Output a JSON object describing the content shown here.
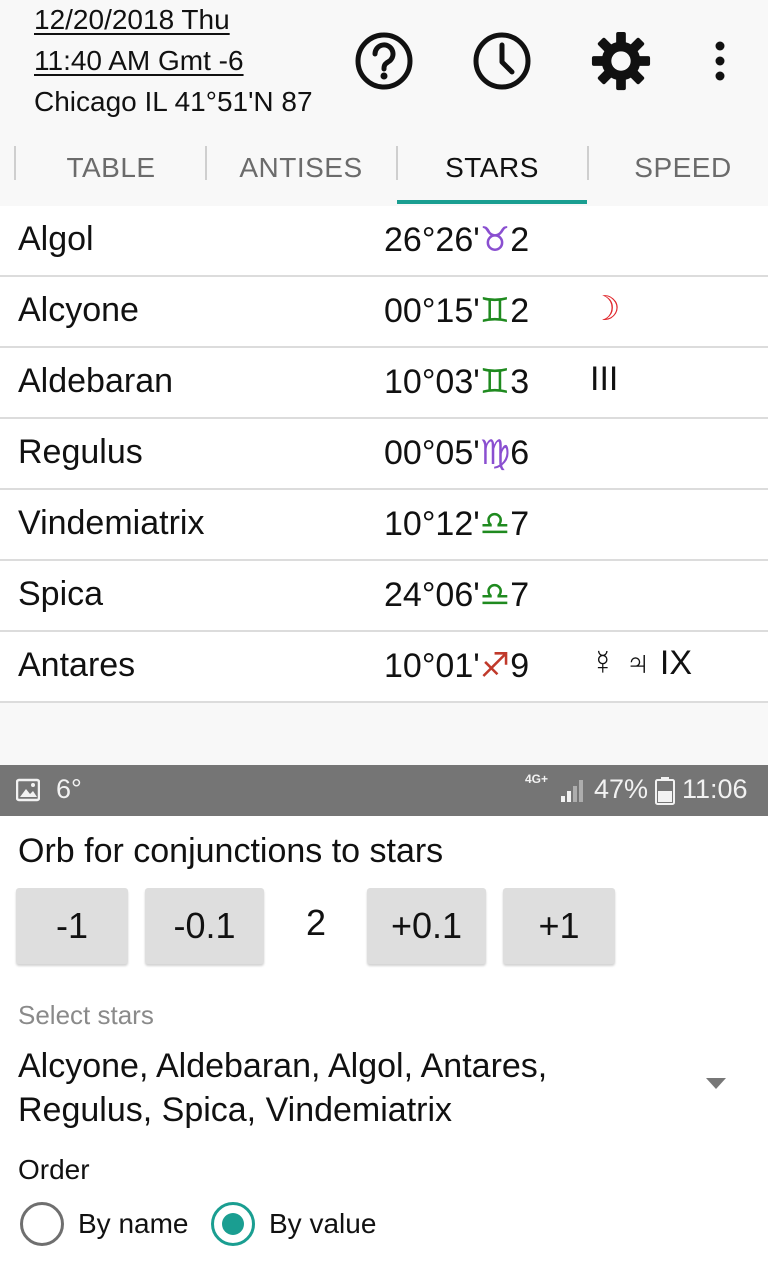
{
  "header": {
    "date": "12/20/2018 Thu",
    "time": "11:40 AM Gmt -6",
    "location": "Chicago IL 41°51'N 87",
    "icons": [
      "help-icon",
      "clock-icon",
      "gear-icon",
      "more-vert-icon"
    ]
  },
  "tabs": [
    {
      "label": "TABLE"
    },
    {
      "label": "ANTISES"
    },
    {
      "label": "STARS",
      "active": true
    },
    {
      "label": "SPEED"
    }
  ],
  "stars": [
    {
      "name": "Algol",
      "pos": "26°26'",
      "sign": "♉",
      "sign_name": "taurus",
      "sign_color": "#8a4fd0",
      "house": "2",
      "extra": "",
      "extra_color": "#111111"
    },
    {
      "name": "Alcyone",
      "pos": "00°15'",
      "sign": "♊",
      "sign_name": "gemini",
      "sign_color": "#1f8a1f",
      "house": "2",
      "extra": "☽",
      "extra_color": "#e0262b"
    },
    {
      "name": "Aldebaran",
      "pos": "10°03'",
      "sign": "♊",
      "sign_name": "gemini",
      "sign_color": "#1f8a1f",
      "house": "3",
      "extra": "III",
      "extra_color": "#111111"
    },
    {
      "name": "Regulus",
      "pos": "00°05'",
      "sign": "♍",
      "sign_name": "virgo",
      "sign_color": "#8a4fd0",
      "house": "6",
      "extra": "",
      "extra_color": "#111111"
    },
    {
      "name": "Vindemiatrix",
      "pos": "10°12'",
      "sign": "♎",
      "sign_name": "libra",
      "sign_color": "#1f8a1f",
      "house": "7",
      "extra": "",
      "extra_color": "#111111"
    },
    {
      "name": "Spica",
      "pos": "24°06'",
      "sign": "♎",
      "sign_name": "libra",
      "sign_color": "#1f8a1f",
      "house": "7",
      "extra": "",
      "extra_color": "#111111"
    },
    {
      "name": "Antares",
      "pos": "10°01'",
      "sign": "♐",
      "sign_name": "sagittarius",
      "sign_color": "#c0392b",
      "house": "9",
      "extra": "☿ ♃ IX",
      "extra_color": "#111111"
    }
  ],
  "statusbar": {
    "temp": "6°",
    "network": "4G+",
    "battery": "47%",
    "clock": "11:06",
    "icons": [
      "image-icon",
      "signal-icon",
      "battery-icon"
    ]
  },
  "settings": {
    "orb_title": "Orb for conjunctions to stars",
    "orb_buttons": [
      "-1",
      "-0.1",
      "+0.1",
      "+1"
    ],
    "orb_value": "2",
    "select_label": "Select stars",
    "select_value": "Alcyone, Aldebaran, Algol, Antares, Regulus, Spica, Vindemiatrix",
    "order_label": "Order",
    "order_options": [
      "By name",
      "By value"
    ],
    "order_selected": "By value"
  },
  "colors": {
    "accent": "#1a9e91",
    "statusbar": "#757575"
  }
}
